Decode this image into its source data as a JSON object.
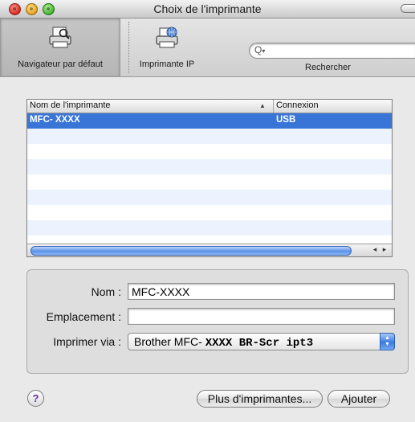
{
  "window": {
    "title": "Choix de l'imprimante"
  },
  "toolbar": {
    "items": [
      {
        "label": "Navigateur par défaut",
        "icon": "default-browser-printer-icon"
      },
      {
        "label": "Imprimante IP",
        "icon": "ip-printer-icon"
      }
    ],
    "search": {
      "label": "Rechercher",
      "placeholder": "",
      "icon": "search-icon"
    }
  },
  "printer_table": {
    "columns": [
      "Nom de l'imprimante",
      "Connexion"
    ],
    "sort_indicator": "▲",
    "rows": [
      {
        "name": "MFC- XXXX",
        "connection": "USB",
        "selected": true
      }
    ]
  },
  "details": {
    "name_label": "Nom :",
    "name_value": "MFC-XXXX",
    "location_label": "Emplacement :",
    "location_value": "",
    "print_via_label": "Imprimer via :",
    "print_via_prefix": "Brother MFC- ",
    "print_via_suffix": "XXXX BR-Scr ipt3"
  },
  "footer": {
    "help_label": "?",
    "more_printers_label": "Plus d'imprimantes...",
    "add_label": "Ajouter"
  },
  "colors": {
    "selection": "#3875d7",
    "alt_row": "#edf3fe",
    "accent": "#3a7be0"
  }
}
